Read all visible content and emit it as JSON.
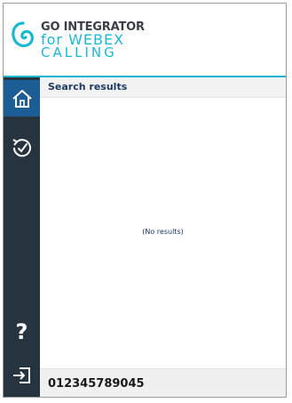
{
  "app": {
    "logo_line1": "GO INTEGRATOR",
    "logo_line2": "for WEBEX",
    "logo_line3": "CALLING"
  },
  "sidebar": {
    "items": [
      {
        "icon": "home-icon",
        "active": true
      },
      {
        "icon": "history-icon",
        "active": false
      },
      {
        "icon": "help-icon",
        "label": "?",
        "active": false
      },
      {
        "icon": "logout-icon",
        "active": false
      }
    ]
  },
  "main": {
    "section_title": "Search results",
    "empty_text": "(No results)"
  },
  "footer": {
    "phone_number": "012345789045"
  },
  "colors": {
    "accent": "#1bb8d2",
    "sidebar": "#263440",
    "active_item": "#1c5d96",
    "text_dark_blue": "#1d3a63"
  }
}
